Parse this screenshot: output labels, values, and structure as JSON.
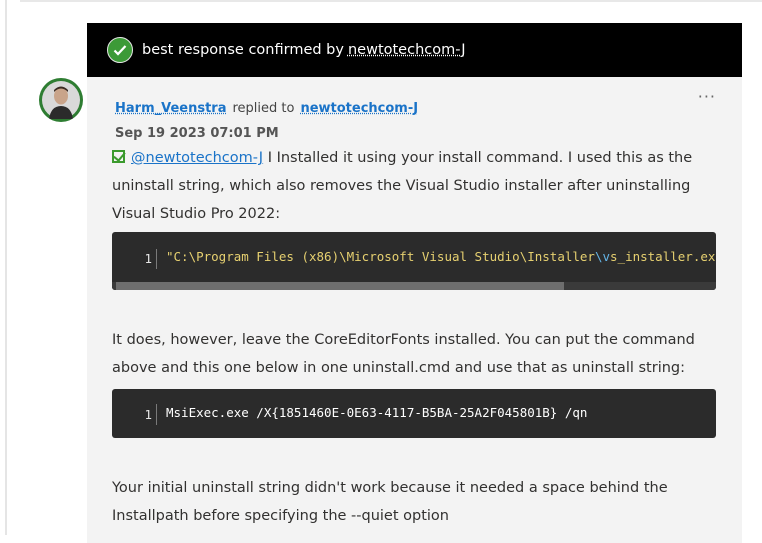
{
  "banner": {
    "text": "best response confirmed by",
    "user": "newtotechcom-J"
  },
  "post": {
    "author": "Harm_Veenstra",
    "replied": "replied to",
    "recipient": "newtotechcom-J",
    "date": "Sep 19 2023  07:01 PM",
    "more_label": "···",
    "mention": "@newtotechcom-J",
    "para1_rest": " I Installed it using your install command. I used this as the uninstall string, which also removes the Visual Studio installer after uninstalling Visual Studio Pro 2022:",
    "code1": {
      "line": "1",
      "text_a": "\"C:\\Program Files (x86)\\Microsoft Visual Studio\\Installer",
      "text_b": "\\v",
      "text_c": "s_installer.exe\" uninstall"
    },
    "para2": "It does, however, leave the CoreEditorFonts installed. You can put the command above and this one below in one uninstall.cmd and use that as uninstall string:",
    "code2": {
      "line": "1",
      "text": "MsiExec.exe /X{1851460E-0E63-4117-B5BA-25A2F045801B} /qn"
    },
    "para3": "Your initial uninstall string didn't work because it needed a space behind the Installpath before specifying the --quiet option"
  },
  "colors": {
    "accent_link": "#1a73c8",
    "check_green": "#3c9a37",
    "banner_bg": "#000000",
    "code_bg": "#2b2b2b"
  },
  "icons": [
    "check-circle-icon",
    "checkbox-icon",
    "more-icon"
  ]
}
